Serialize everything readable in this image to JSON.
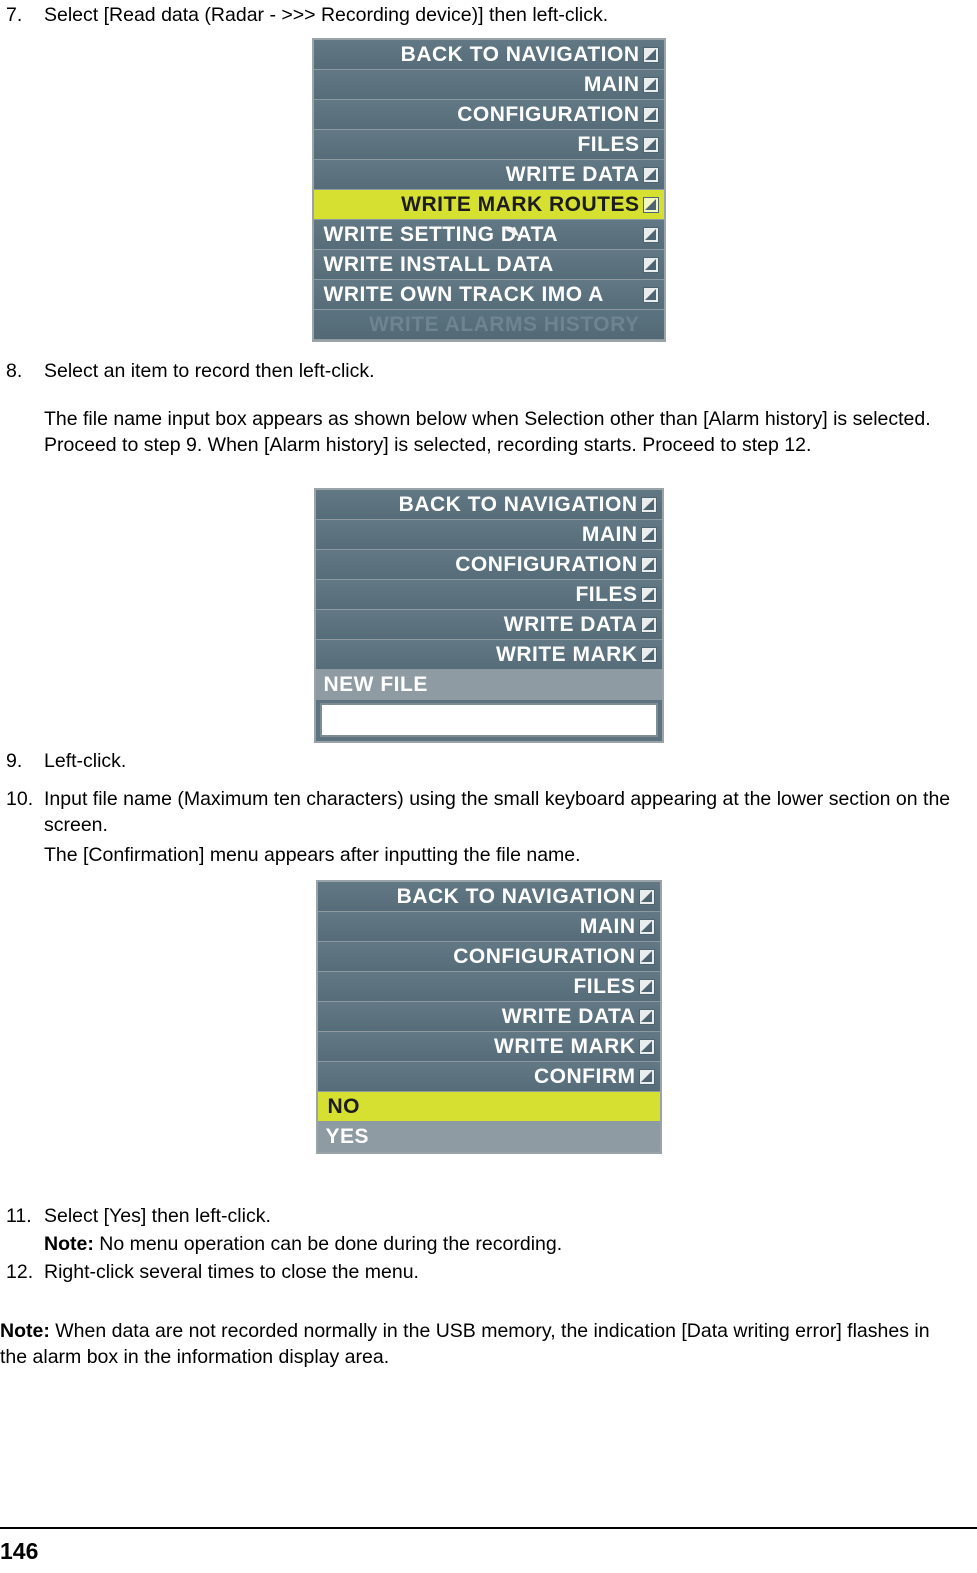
{
  "document": {
    "page_number": "146",
    "steps": [
      {
        "num": "7.",
        "text": "Select [Read data (Radar - >>> Recording device)] then left-click."
      },
      {
        "num": "8.",
        "text": "Select an item to record then left-click."
      },
      {
        "num": "9.",
        "text": "Left-click."
      },
      {
        "num": "10.",
        "text": "Input file name (Maximum ten characters) using the small keyboard appearing at the lower section on the screen."
      },
      {
        "num": "11.",
        "text": "Select [Yes] then left-click."
      },
      {
        "num": "12.",
        "text": "Right-click several times to close the menu."
      }
    ],
    "paragraphs": {
      "after_step8": "The file name input box appears as shown below when Selection other than [Alarm history] is selected. Proceed to step 9. When [Alarm history] is selected, recording starts. Proceed to step 12.",
      "after_step10": "The [Confirmation] menu appears after inputting the file name.",
      "note_step11_label": "Note:",
      "note_step11_text": " No menu operation can be done during the recording.",
      "final_note_label": "Note:",
      "final_note_text": " When data are not recorded normally in the USB memory, the indication [Data writing error] flashes in the alarm box in the information display area."
    }
  },
  "menu1": {
    "name": "write-data-menu",
    "rows": [
      {
        "label": "BACK TO NAVIGATION",
        "style": "normal",
        "arrow": true
      },
      {
        "label": "MAIN",
        "style": "normal",
        "arrow": true
      },
      {
        "label": "CONFIGURATION",
        "style": "normal",
        "arrow": true
      },
      {
        "label": "FILES",
        "style": "normal",
        "arrow": true
      },
      {
        "label": "WRITE DATA",
        "style": "normal",
        "arrow": true
      },
      {
        "label": "WRITE MARK ROUTES",
        "style": "highlight",
        "arrow": true
      },
      {
        "label": "WRITE SETTING DATA",
        "style": "left",
        "arrow": true
      },
      {
        "label": "WRITE INSTALL DATA",
        "style": "left",
        "arrow": true
      },
      {
        "label": "WRITE OWN TRACK IMO A",
        "style": "left",
        "arrow": true
      },
      {
        "label": "WRITE ALARMS HISTORY",
        "style": "dim",
        "arrow": false
      }
    ]
  },
  "menu2": {
    "name": "new-file-menu",
    "rows": [
      {
        "label": "BACK TO NAVIGATION",
        "style": "normal",
        "arrow": true
      },
      {
        "label": "MAIN",
        "style": "normal",
        "arrow": true
      },
      {
        "label": "CONFIGURATION",
        "style": "normal",
        "arrow": true
      },
      {
        "label": "FILES",
        "style": "normal",
        "arrow": true
      },
      {
        "label": "WRITE DATA",
        "style": "normal",
        "arrow": true
      },
      {
        "label": "WRITE MARK",
        "style": "normal",
        "arrow": true
      },
      {
        "label": "NEW FILE",
        "style": "plain",
        "arrow": false
      }
    ],
    "input_value": ""
  },
  "menu3": {
    "name": "confirm-menu",
    "rows": [
      {
        "label": "BACK TO NAVIGATION",
        "style": "normal",
        "arrow": true
      },
      {
        "label": "MAIN",
        "style": "normal",
        "arrow": true
      },
      {
        "label": "CONFIGURATION",
        "style": "normal",
        "arrow": true
      },
      {
        "label": "FILES",
        "style": "normal",
        "arrow": true
      },
      {
        "label": "WRITE DATA",
        "style": "normal",
        "arrow": true
      },
      {
        "label": "WRITE MARK",
        "style": "normal",
        "arrow": true
      },
      {
        "label": "CONFIRM",
        "style": "normal",
        "arrow": true
      },
      {
        "label": "NO",
        "style": "highlight-left",
        "arrow": false
      },
      {
        "label": "YES",
        "style": "plain",
        "arrow": false
      }
    ]
  }
}
